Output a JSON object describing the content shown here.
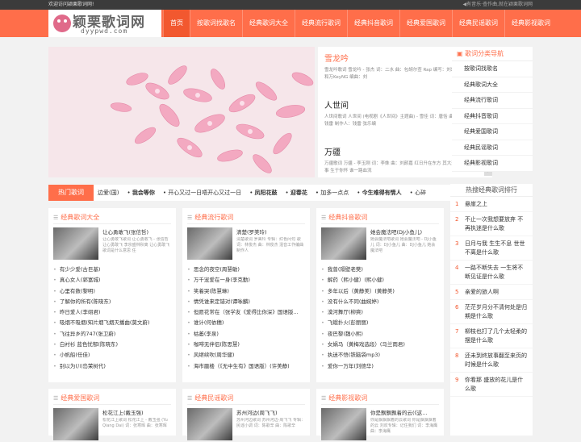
{
  "topbar": {
    "welcome": "欢迎访问颖栗歌词网!",
    "right": "有音乐·查作曲,就在颖栗歌词网"
  },
  "logo": {
    "title": "颖栗歌词网",
    "sub": "dyypwd.com"
  },
  "nav": [
    "首页",
    "按歌词找歌名",
    "经典歌词大全",
    "经典流行歌词",
    "经典抖音歌词",
    "经典爱国歌词",
    "经典民谣歌词",
    "经典影视歌词"
  ],
  "news": [
    {
      "title": "雪龙吟",
      "desc": "雪龙吟歌词 雪龙吟 - 张杰 词：二水 曲：包胡尔查 Rap 编写：刘乐 Rap Flow：热和万KeyNG 编曲：刘"
    },
    {
      "title": "人世间",
      "desc": "人世间歌词 人世间 (电视剧《人世间》主题曲) - 雪佳 词：唐恬 曲：钱雷 编曲：钱雷 制作人：钱雷 弦乐编"
    },
    {
      "title": "万疆",
      "desc": "万疆歌词 万疆 - 李玉刚 词：李姝 曲：刘颜嘉 红日升在东方 其大道满霞光 我到其事 生于你怀 谁一路血流"
    }
  ],
  "scroll": {
    "up": "‹",
    "down": "›"
  },
  "sidebar_nav": {
    "title": "歌词分类导航",
    "items": [
      "按歌词找歌名",
      "经典歌词大全",
      "经典流行歌词",
      "经典抖音歌词",
      "经典爱国歌词",
      "经典民谣歌词",
      "经典影视歌词"
    ]
  },
  "hot": {
    "label": "热门歌词",
    "items": [
      {
        "text": "边爱(国)",
        "bold": false
      },
      {
        "text": "我会等你",
        "bold": true
      },
      {
        "text": "开心又过一日唔开心又过一日",
        "bold": false
      },
      {
        "text": "凤阳花鼓",
        "bold": true
      },
      {
        "text": "迎春花",
        "bold": true
      },
      {
        "text": "加多一点点",
        "bold": false
      },
      {
        "text": "今生难得有情人",
        "bold": true
      },
      {
        "text": "心碎",
        "bold": false
      }
    ]
  },
  "cards": [
    {
      "title": "经典歌词大全",
      "feat_title": "让心勇敢飞(张信哲)",
      "feat_desc": "让心勇敢飞歌词 让心勇敢飞 - 张信哲 让心勇敢飞 李宗盛林秋离 让心勇敢飞 歌词是什么意思 任",
      "items": [
        "有少少爱(古巨基)",
        "真心女人(郭富城)",
        "心里有数(黎明)",
        "了解你的所有(陈晓东)",
        "昨日爱人(李翊君)",
        "吸烟不吸烟(知片烟飞烟灭播曲(莫文蔚)",
        "飞往异乡的747(张卫蔚)",
        "白衬衫 蓝色忧郁(陈晓东)",
        "小帆船(任佳)",
        "别以为(川岛茉树代)"
      ]
    },
    {
      "title": "经典流行歌词",
      "feat_title": "清楚(罗美玲)",
      "feat_desc": "清楚歌词 罗美玲 专辑：红色问句 歌词：林俊杰 曲：林俊杰 混音工作编曲 制作人",
      "items": [
        "思念的夜空(周慧敏)",
        "万千宠爱在一身(李克勤)",
        "笑着哭(陈慧琳)",
        "情凭谁来定错对(谭咏麟)",
        "但愿花常在（张学友《爱得比你深》国语版...",
        "谁计(何依穗)",
        "枯萎(李泉)",
        "咖啡无伴侣(陈思慧)",
        "风继续吹(周华健)",
        "海市蜃楼（《无中生有》国语版）(许美静)"
      ]
    },
    {
      "title": "经典抖音歌词",
      "feat_title": "她会魔法吧(DJ小鱼儿)",
      "feat_desc": "她会魔法吧歌词 她会魔法吧 - DJ小鱼儿 词：DJ小鱼儿 曲：DJ小鱼儿 她会魔法吧",
      "items": [
        "我曾(隔壁老樊)",
        "解药（熙小健）(熙小健)",
        "多年以后（黄静美）(黄静美)",
        "没有什么不同(曲婉婷)",
        "漠河舞厅(柳爽)",
        "飞蛾扑火(彭丽丽)",
        "夜巴黎(魏小熙)",
        "女娲马（黄梅戏选段）(马兰雨君)",
        "执迷不悟(铁脑袋mp3)",
        "爱你一万年(刘德华)"
      ]
    }
  ],
  "cards2": [
    {
      "title": "经典爱国歌词",
      "feat_title": "松花江上(戴玉强)",
      "feat_desc": "松花江上歌词 松花江上 - 戴玉强 (Yu Qiang Dai) 词：张寒晖 曲：张寒晖"
    },
    {
      "title": "经典民谣歌词",
      "feat_title": "苏州河边(周飞飞)",
      "feat_desc": "苏州河边歌词 苏州河边-周飞飞 专辑：民谣小调 词：陈歌辛 曲：陈歌辛"
    },
    {
      "title": "经典影视歌词",
      "feat_title": "你是飘飘飘着的云(《这...",
      "feat_desc": "你是飘飘飘着的云歌词 你是飘飘飘着的云 刘欢专辑：记住我们 词：李海鹰 曲：李海鹰"
    }
  ],
  "rank": {
    "title": "热搜经典歌词排行",
    "items": [
      {
        "num": "1",
        "text": "悬崖之上"
      },
      {
        "num": "2",
        "text": "不止一次我想要放弃 不再执迷是什么歌"
      },
      {
        "num": "3",
        "text": "日月与我 生生不息 世世不离是什么歌"
      },
      {
        "num": "4",
        "text": "一路不断失去 一生将不断见证是什么歌"
      },
      {
        "num": "5",
        "text": "亲爱的旅人啊"
      },
      {
        "num": "6",
        "text": "茫茫岁月分不清何处是归期是什么歌"
      },
      {
        "num": "7",
        "text": "柳枝也打了几个太轻柔的摆是什么歌"
      },
      {
        "num": "8",
        "text": "还未到终放事翻至来页的时候是什么歌"
      },
      {
        "num": "9",
        "text": "你看那 盛放的花儿是什么歌"
      }
    ]
  }
}
